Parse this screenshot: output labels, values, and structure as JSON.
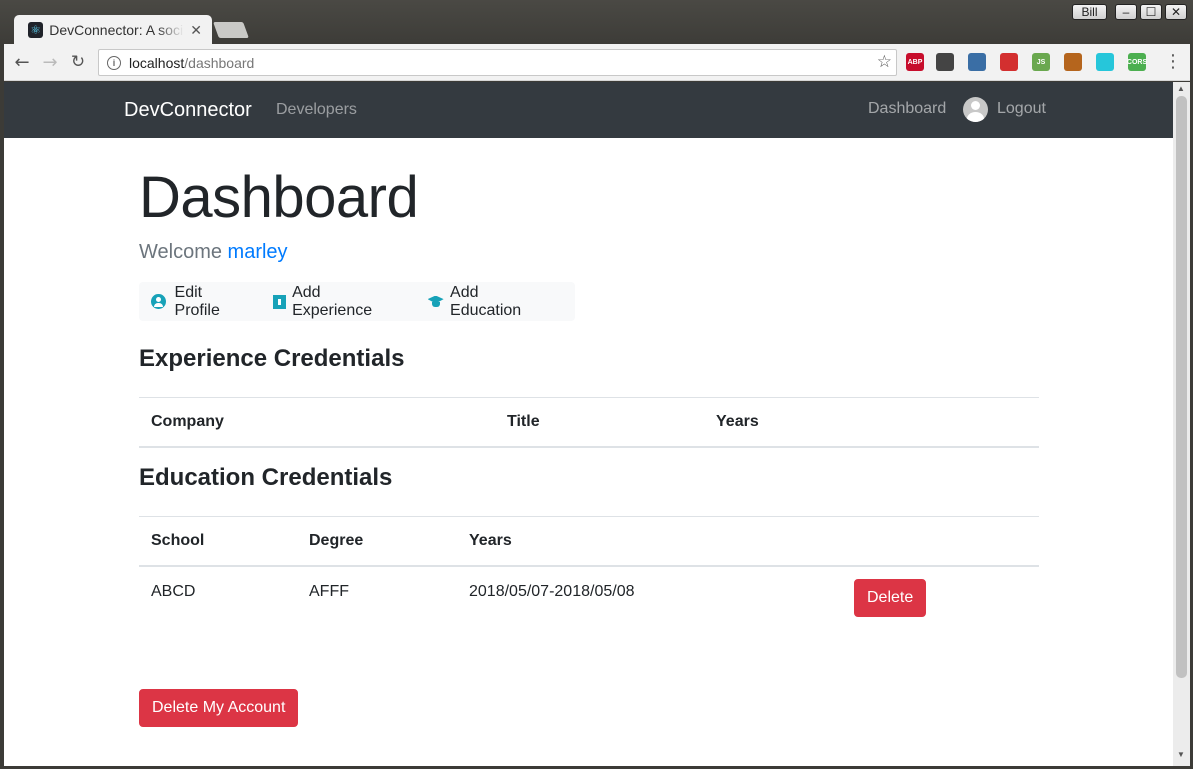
{
  "browser": {
    "tab_title": "DevConnector: A social network for developers",
    "user_button": "Bill",
    "url_host": "localhost",
    "url_path": "/dashboard",
    "extensions": [
      {
        "name": "adblock-icon",
        "label": "ABP",
        "color": "#c70d2c"
      },
      {
        "name": "sync-icon",
        "label": "",
        "color": "#444444"
      },
      {
        "name": "colorpicker-icon",
        "label": "",
        "color": "#3a6ea5"
      },
      {
        "name": "extension-red-icon",
        "label": "",
        "color": "#d32f2f"
      },
      {
        "name": "nodejs-icon",
        "label": "JS",
        "color": "#6aa84f"
      },
      {
        "name": "monkey-icon",
        "label": "",
        "color": "#b5651d"
      },
      {
        "name": "circle-icon",
        "label": "",
        "color": "#26c6da"
      },
      {
        "name": "cors-icon",
        "label": "CORS",
        "color": "#4caf50"
      }
    ]
  },
  "navbar": {
    "brand": "DevConnector",
    "developers": "Developers",
    "dashboard": "Dashboard",
    "logout": "Logout"
  },
  "page": {
    "title": "Dashboard",
    "welcome_prefix": "Welcome ",
    "welcome_user": "marley",
    "actions": {
      "edit_profile": "Edit Profile",
      "add_experience": "Add Experience",
      "add_education": "Add Education"
    },
    "experience": {
      "title": "Experience Credentials",
      "headers": [
        "Company",
        "Title",
        "Years"
      ]
    },
    "education": {
      "title": "Education Credentials",
      "headers": [
        "School",
        "Degree",
        "Years"
      ],
      "rows": [
        {
          "school": "ABCD",
          "degree": "AFFF",
          "years": "2018/05/07-2018/05/08",
          "delete_label": "Delete"
        }
      ]
    },
    "delete_account": "Delete My Account"
  },
  "colors": {
    "navbar_bg": "#343a40",
    "link": "#007bff",
    "info": "#17a2b8",
    "danger": "#dc3545"
  }
}
